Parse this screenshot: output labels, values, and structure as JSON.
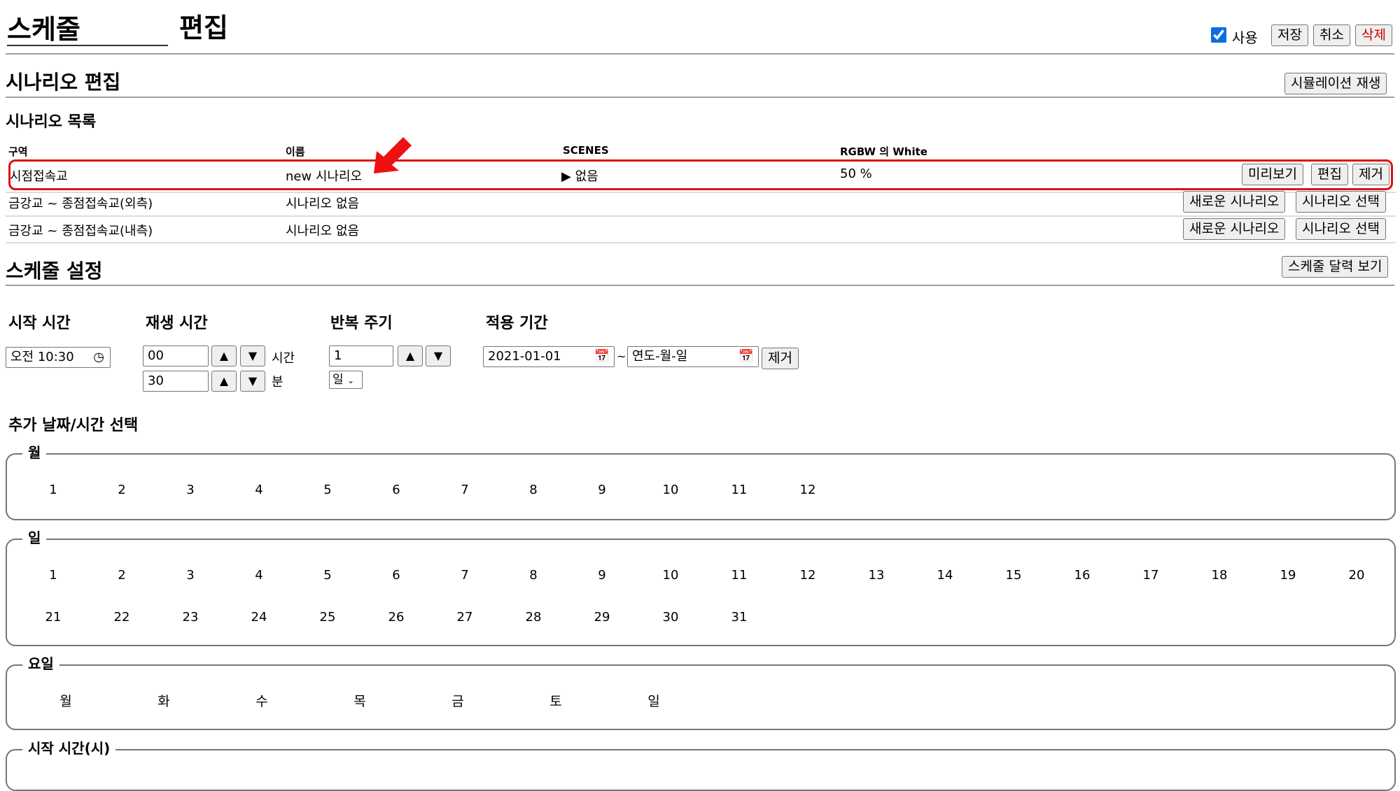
{
  "header": {
    "title_left": "스케줄",
    "title_right": "편집",
    "enabled_label": "사용",
    "enabled": true,
    "save_label": "저장",
    "cancel_label": "취소",
    "delete_label": "삭제",
    "delete_color": "#cc0000"
  },
  "scenario_edit": {
    "heading": "시나리오 편집",
    "simulate_label": "시뮬레이션 재생"
  },
  "scenario_list": {
    "heading": "시나리오 목록",
    "columns": [
      "구역",
      "이름",
      "SCENES",
      "RGBW 의 White"
    ],
    "rows": [
      {
        "zone": "시점접속교",
        "name": "new 시나리오",
        "scenes": "없음",
        "white": "50 %",
        "actions": [
          "미리보기",
          "편집",
          "제거"
        ]
      },
      {
        "zone": "금강교 ~ 종점접속교(외측)",
        "name": "시나리오 없음",
        "actions": [
          "새로운 시나리오",
          "시나리오 선택"
        ]
      },
      {
        "zone": "금강교 ~ 종점접속교(내측)",
        "name": "시나리오 없음",
        "actions": [
          "새로운 시나리오",
          "시나리오 선택"
        ]
      }
    ],
    "highlight_color": "#dd1111"
  },
  "schedule": {
    "heading": "스케줄 설정",
    "calendar_label": "스케줄 달력 보기",
    "start_time": {
      "label": "시작 시간",
      "value": "오전 10:30"
    },
    "play_time": {
      "label": "재생 시간",
      "hours": "00",
      "hours_unit": "시간",
      "minutes": "30",
      "minutes_unit": "분"
    },
    "repeat": {
      "label": "반복 주기",
      "value": "1",
      "unit": "일"
    },
    "period": {
      "label": "적용 기간",
      "from": "2021-01-01",
      "tilde": "~",
      "to_placeholder": "연도-월-일",
      "remove_label": "제거"
    }
  },
  "extra": {
    "heading": "추가 날짜/시간 선택",
    "months": {
      "legend": "월",
      "items": [
        "1",
        "2",
        "3",
        "4",
        "5",
        "6",
        "7",
        "8",
        "9",
        "10",
        "11",
        "12"
      ]
    },
    "days": {
      "legend": "일",
      "items": [
        "1",
        "2",
        "3",
        "4",
        "5",
        "6",
        "7",
        "8",
        "9",
        "10",
        "11",
        "12",
        "13",
        "14",
        "15",
        "16",
        "17",
        "18",
        "19",
        "20",
        "21",
        "22",
        "23",
        "24",
        "25",
        "26",
        "27",
        "28",
        "29",
        "30",
        "31"
      ]
    },
    "weekdays": {
      "legend": "요일",
      "items": [
        "월",
        "화",
        "수",
        "목",
        "금",
        "토",
        "일"
      ]
    },
    "hours": {
      "legend": "시작 시간(시)"
    }
  },
  "icons": {
    "arrow": "pointer-arrow-icon",
    "clock": "clock-icon",
    "calendar": "calendar-icon"
  }
}
